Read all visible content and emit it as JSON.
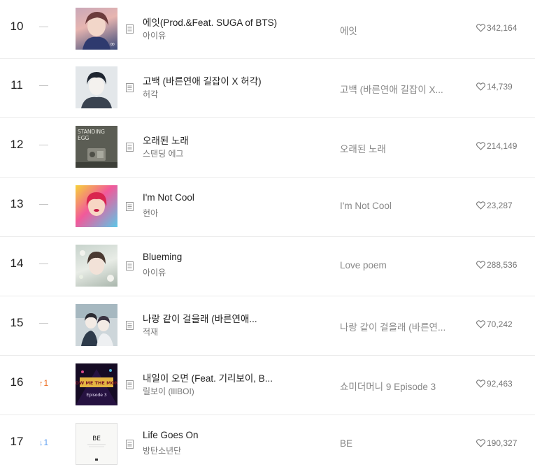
{
  "chart": {
    "rows": [
      {
        "rank": "10",
        "change": "",
        "change_dir": "none",
        "title": "에잇(Prod.&Feat. SUGA of BTS)",
        "artist": "아이유",
        "album": "에잇",
        "likes": "342,164"
      },
      {
        "rank": "11",
        "change": "",
        "change_dir": "none",
        "title": "고백 (바른연애 길잡이 X 허각)",
        "artist": "허각",
        "album": "고백 (바른연애 길잡이 X...",
        "likes": "14,739"
      },
      {
        "rank": "12",
        "change": "",
        "change_dir": "none",
        "title": "오래된 노래",
        "artist": "스탠딩 에그",
        "album": "오래된 노래",
        "likes": "214,149"
      },
      {
        "rank": "13",
        "change": "",
        "change_dir": "none",
        "title": "I'm Not Cool",
        "artist": "현아",
        "album": "I'm Not Cool",
        "likes": "23,287"
      },
      {
        "rank": "14",
        "change": "",
        "change_dir": "none",
        "title": "Blueming",
        "artist": "아이유",
        "album": "Love poem",
        "likes": "288,536"
      },
      {
        "rank": "15",
        "change": "",
        "change_dir": "none",
        "title": "나랑 같이 걸을래 (바른연애...",
        "artist": "적재",
        "album": "나랑 같이 걸을래 (바른연...",
        "likes": "70,242"
      },
      {
        "rank": "16",
        "change": "1",
        "change_dir": "up",
        "title": "내일이 오면 (Feat. 기리보이, B...",
        "artist": "릴보이 (lIlBOI)",
        "album": "쇼미더머니 9 Episode 3",
        "likes": "92,463"
      },
      {
        "rank": "17",
        "change": "1",
        "change_dir": "down",
        "title": "Life Goes On",
        "artist": "방탄소년단",
        "album": "BE",
        "likes": "190,327"
      }
    ],
    "art_text": {
      "eight_badge": "∞",
      "standing_egg": "STANDING",
      "standing_egg2": "EGG",
      "smtm": "SHOW ME THE MONEY",
      "smtm_ep": "Episode 3",
      "be": "BE"
    },
    "icons": {
      "unchanged": "dash-icon",
      "up": "up-arrow-icon",
      "down": "down-arrow-icon",
      "lyrics": "lyrics-icon",
      "like": "heart-icon"
    },
    "colors": {
      "up": "#ed6e22",
      "down": "#5c9df0",
      "text": "#222222",
      "subtext": "#777777"
    }
  }
}
